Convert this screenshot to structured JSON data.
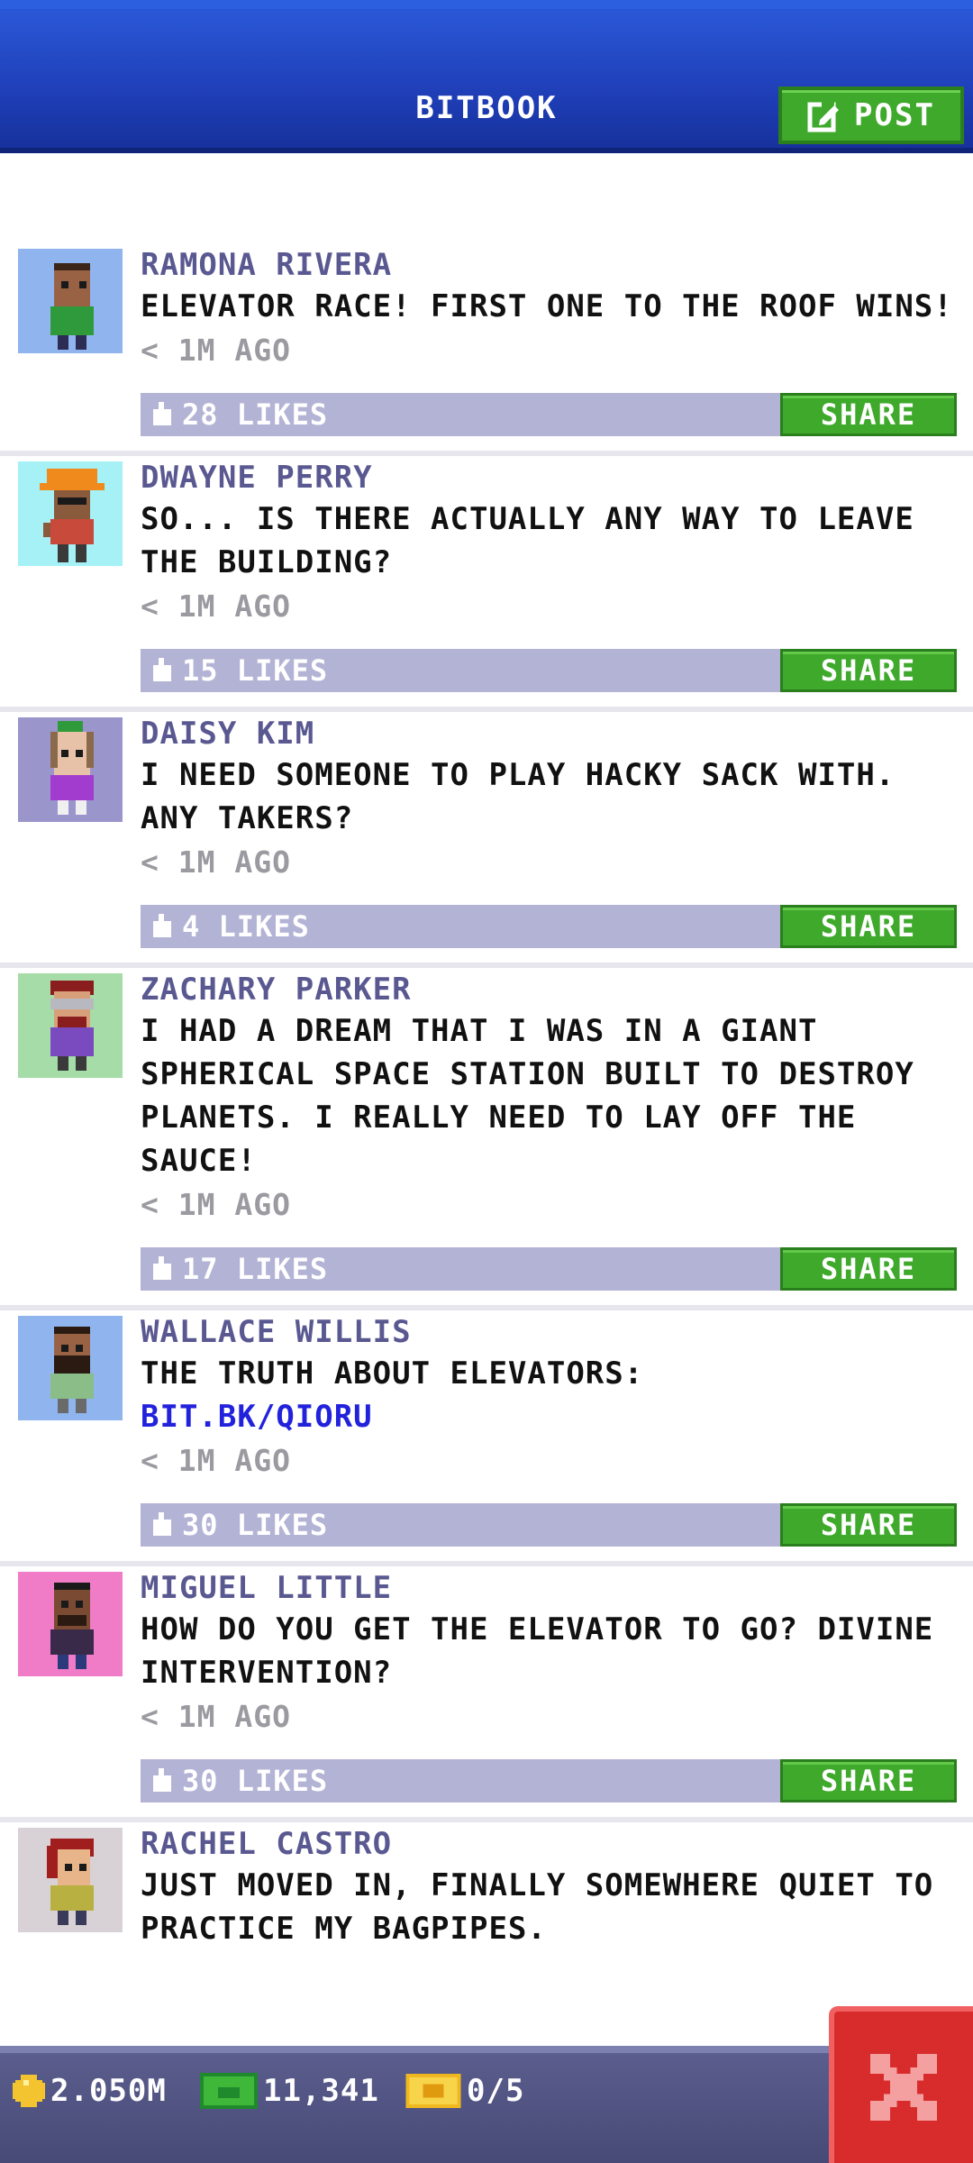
{
  "header": {
    "title": "BITBOOK",
    "post_label": "POST"
  },
  "colors": {
    "header_blue": "#1f3fb8",
    "accent_green": "#3fa92c",
    "author_purple": "#5a5891",
    "likes_bar": "#b3b3d6",
    "close_red": "#d82c2c"
  },
  "posts": [
    {
      "author": "RAMONA RIVERA",
      "text": "ELEVATOR RACE! FIRST ONE TO THE ROOF WINS!",
      "link": "",
      "time": "< 1M AGO",
      "likes": "28 LIKES",
      "share": "SHARE",
      "avatar_bg": "#8fb4ee"
    },
    {
      "author": "DWAYNE PERRY",
      "text": "SO... IS THERE ACTUALLY ANY WAY TO LEAVE THE BUILDING?",
      "link": "",
      "time": "< 1M AGO",
      "likes": "15 LIKES",
      "share": "SHARE",
      "avatar_bg": "#a6f1f6"
    },
    {
      "author": "DAISY KIM",
      "text": "I NEED SOMEONE TO PLAY HACKY SACK WITH. ANY TAKERS?",
      "link": "",
      "time": "< 1M AGO",
      "likes": "4 LIKES",
      "share": "SHARE",
      "avatar_bg": "#9a96cc"
    },
    {
      "author": "ZACHARY PARKER",
      "text": "I HAD A DREAM THAT I WAS IN A GIANT SPHERICAL SPACE STATION BUILT TO DESTROY PLANETS. I REALLY NEED TO LAY OFF THE SAUCE!",
      "link": "",
      "time": "< 1M AGO",
      "likes": "17 LIKES",
      "share": "SHARE",
      "avatar_bg": "#a6dca8"
    },
    {
      "author": "WALLACE WILLIS",
      "text": "THE TRUTH ABOUT ELEVATORS:",
      "link": "BIT.BK/QIORU",
      "time": "< 1M AGO",
      "likes": "30 LIKES",
      "share": "SHARE",
      "avatar_bg": "#8fb4ee"
    },
    {
      "author": "MIGUEL LITTLE",
      "text": "HOW DO YOU GET THE ELEVATOR TO GO? DIVINE INTERVENTION?",
      "link": "",
      "time": "< 1M AGO",
      "likes": "30 LIKES",
      "share": "SHARE",
      "avatar_bg": "#f07cc8"
    },
    {
      "author": "RACHEL CASTRO",
      "text": "JUST MOVED IN, FINALLY SOMEWHERE QUIET TO PRACTICE MY BAGPIPES.",
      "link": "",
      "time": "",
      "likes": "",
      "share": "",
      "avatar_bg": "#d8d2d6"
    }
  ],
  "status": {
    "coins": "2.050M",
    "bux": "11,341",
    "tickets": "0/5"
  }
}
